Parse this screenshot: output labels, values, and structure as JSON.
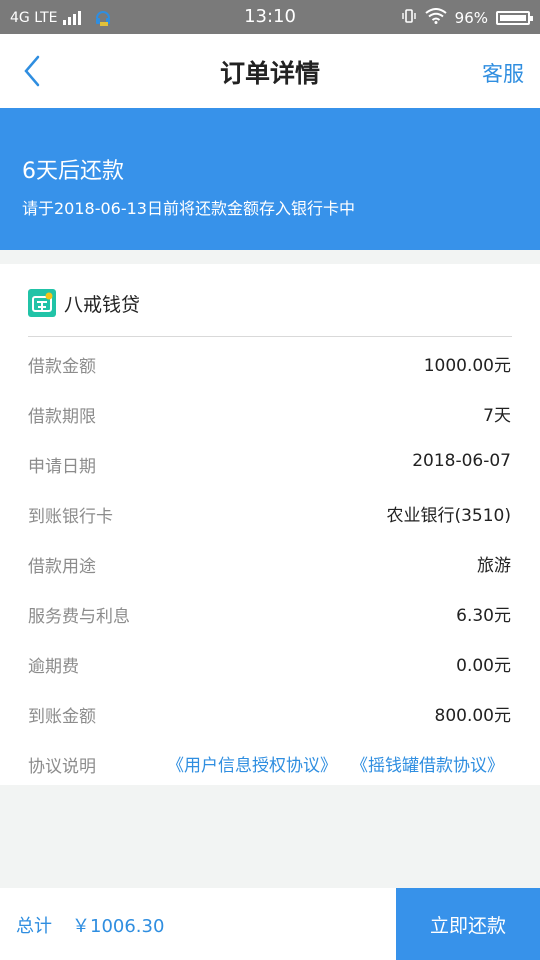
{
  "status_bar": {
    "network": "4G LTE",
    "time": "13:10",
    "battery": "96%"
  },
  "nav": {
    "title": "订单详情",
    "service": "客服"
  },
  "banner": {
    "title": "6天后还款",
    "subtitle": "请于2018-06-13日前将还款金额存入银行卡中"
  },
  "lender": {
    "name": "八戒钱贷"
  },
  "details": [
    {
      "label": "借款金额",
      "value": "1000.00元"
    },
    {
      "label": "借款期限",
      "value": "7天"
    },
    {
      "label": "申请日期",
      "value": "2018-06-07"
    },
    {
      "label": "到账银行卡",
      "value": "农业银行(3510)"
    },
    {
      "label": "借款用途",
      "value": "旅游"
    },
    {
      "label": "服务费与利息",
      "value": "6.30元"
    },
    {
      "label": "逾期费",
      "value": "0.00元"
    },
    {
      "label": "到账金额",
      "value": "800.00元"
    }
  ],
  "agreement": {
    "label": "协议说明",
    "link1": "《用户信息授权协议》",
    "link2": "《摇钱罐借款协议》"
  },
  "bottom": {
    "total_label": "总计",
    "total_value": "￥1006.30",
    "pay_label": "立即还款"
  },
  "colors": {
    "accent": "#3792ea",
    "link": "#2f8ee0",
    "logo": "#21c3a7"
  }
}
